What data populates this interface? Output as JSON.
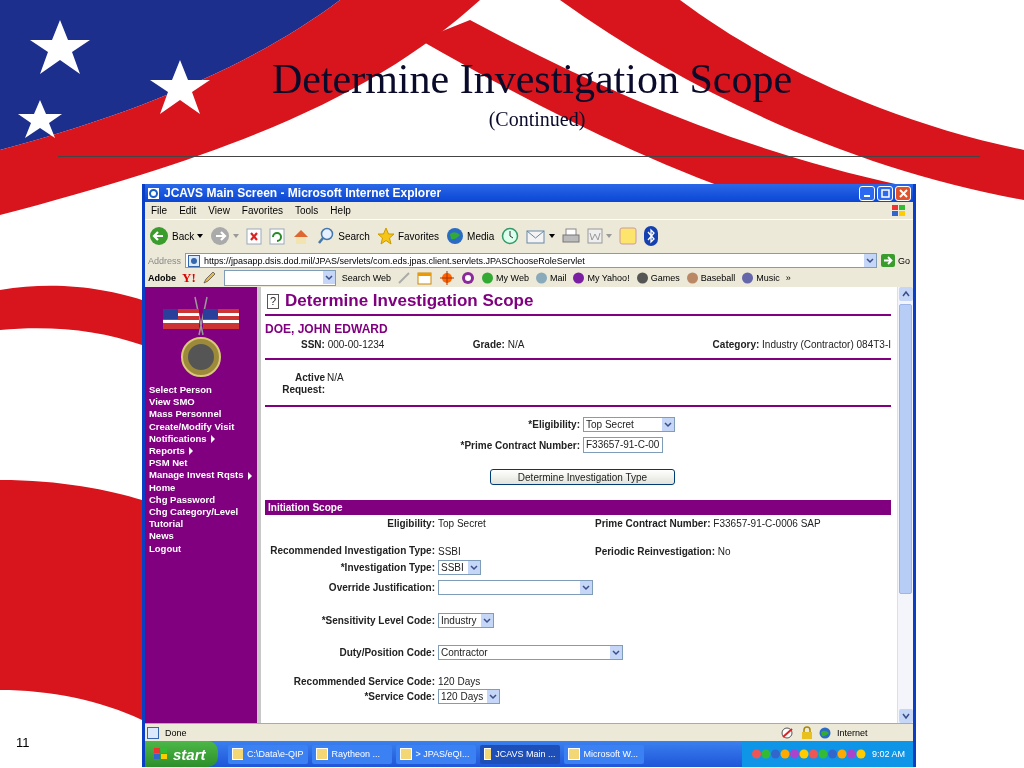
{
  "slide": {
    "title": "Determine Investigation Scope",
    "subtitle": "(Continued)",
    "page_number": "11"
  },
  "browser": {
    "title": "JCAVS Main Screen - Microsoft Internet Explorer",
    "menu": [
      "File",
      "Edit",
      "View",
      "Favorites",
      "Tools",
      "Help"
    ],
    "toolbar": [
      {
        "kind": "back",
        "label": "Back"
      },
      {
        "kind": "forward"
      },
      {
        "kind": "stop"
      },
      {
        "kind": "refresh"
      },
      {
        "kind": "home"
      },
      {
        "kind": "search",
        "label": "Search"
      },
      {
        "kind": "favorites",
        "label": "Favorites"
      },
      {
        "kind": "media",
        "label": "Media"
      },
      {
        "kind": "history"
      },
      {
        "kind": "mail"
      },
      {
        "kind": "print"
      },
      {
        "kind": "word"
      },
      {
        "kind": "note"
      },
      {
        "kind": "bluetooth"
      }
    ],
    "address": {
      "label": "Address",
      "url": "https://jpasapp.dsis.dod.mil/JPAS/servlets/com.eds.jpas.client.servlets.JPASChooseRoleServlet",
      "go": "Go"
    },
    "links": [
      {
        "kind": "adobe",
        "label": "Adobe"
      },
      {
        "kind": "yahoo",
        "label": "Y!"
      },
      {
        "kind": "pencil"
      },
      {
        "kind": "search-box"
      },
      {
        "kind": "button",
        "label": "Search Web"
      },
      {
        "kind": "highlight"
      },
      {
        "kind": "calendar"
      },
      {
        "kind": "target"
      },
      {
        "kind": "circle"
      },
      {
        "kind": "myweb",
        "label": "My Web"
      },
      {
        "kind": "mail",
        "label": "Mail"
      },
      {
        "kind": "myyahoo",
        "label": "My Yahoo!"
      },
      {
        "kind": "games",
        "label": "Games"
      },
      {
        "kind": "baseball",
        "label": "Baseball"
      },
      {
        "kind": "music",
        "label": "Music"
      },
      {
        "kind": "more",
        "label": "»"
      }
    ],
    "status": "Done",
    "zone": "Internet"
  },
  "sidebar": {
    "items": [
      {
        "label": "Select Person",
        "submenu": false
      },
      {
        "label": "View SMO",
        "submenu": false
      },
      {
        "label": "Mass Personnel",
        "submenu": false
      },
      {
        "label": "Create/Modify Visit",
        "submenu": false
      },
      {
        "label": "Notifications",
        "submenu": true
      },
      {
        "label": "Reports",
        "submenu": true
      },
      {
        "label": "PSM Net",
        "submenu": false
      },
      {
        "label": "Manage Invest Rqsts",
        "submenu": true
      },
      {
        "label": "Home",
        "submenu": false
      },
      {
        "label": "Chg Password",
        "submenu": false
      },
      {
        "label": "Chg Category/Level",
        "submenu": false
      },
      {
        "label": "Tutorial",
        "submenu": false
      },
      {
        "label": "News",
        "submenu": false
      },
      {
        "label": "Logout",
        "submenu": false
      }
    ]
  },
  "page": {
    "help": "?",
    "heading": "Determine Investigation Scope",
    "person": "DOE, JOHN EDWARD",
    "info": [
      {
        "label": "SSN:",
        "value": "000-00-1234"
      },
      {
        "label": "Grade:",
        "value": "N/A"
      },
      {
        "label": "Category:",
        "value": "Industry (Contractor) 084T3-I"
      }
    ],
    "active_request": {
      "label": "Active Request:",
      "value": "N/A"
    },
    "eligibility": {
      "label": "*Eligibility:",
      "value": "Top Secret"
    },
    "contract": {
      "label": "*Prime Contract Number:",
      "value": "F33657-91-C-00"
    },
    "button": "Determine Investigation Type",
    "scope": {
      "header": "Initiation Scope",
      "summary": [
        {
          "label": "Eligibility:",
          "value": "Top Secret",
          "label2": "Prime Contract Number:",
          "value2": "F33657-91-C-0006 SAP"
        },
        {
          "label": "Recommended Investigation Type:",
          "value": "SSBI",
          "label2": "Periodic Reinvestigation:",
          "value2": "No"
        }
      ],
      "fields": [
        {
          "kind": "short-select",
          "label": "*Investigation Type:",
          "value": "SSBI"
        },
        {
          "kind": "long-select",
          "label": "Override Justification:"
        },
        {
          "kind": "short-select",
          "label": "*Sensitivity Level Code:",
          "value": "Industry"
        },
        {
          "kind": "long-select",
          "label": "Duty/Position Code:",
          "value": "Contractor"
        },
        {
          "kind": "text",
          "label": "Recommended Service Code:",
          "value": "120 Days"
        },
        {
          "kind": "short-select",
          "label": "*Service Code:",
          "value": "120 Days"
        }
      ]
    }
  },
  "taskbar": {
    "start": "start",
    "tasks": [
      {
        "label": "C:\\Data\\e-QIP",
        "selected": false
      },
      {
        "label": "Raytheon ...",
        "selected": false
      },
      {
        "label": "> JPAS/eQI...",
        "selected": false
      },
      {
        "label": "JCAVS Main ...",
        "selected": true
      },
      {
        "label": "Microsoft W...",
        "selected": false
      }
    ],
    "clock": "9:02 AM"
  }
}
